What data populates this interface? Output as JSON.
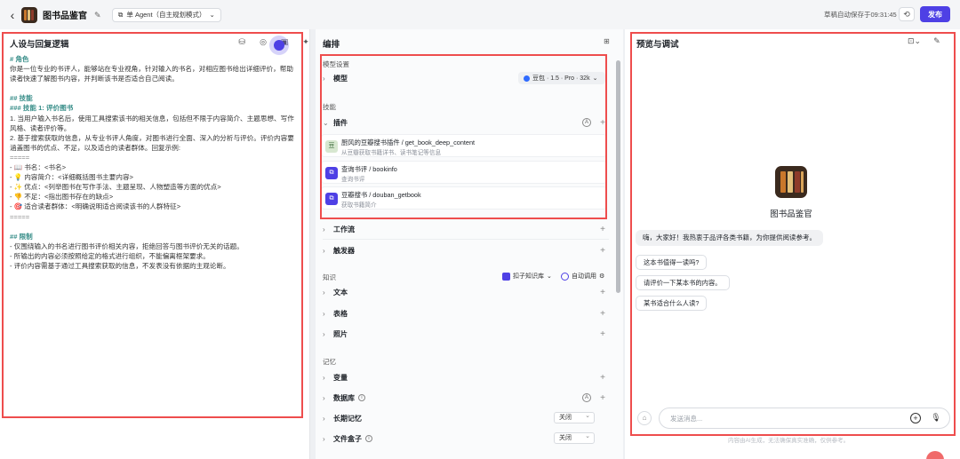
{
  "header": {
    "back_icon": "chevron-left-icon",
    "app_title": "图书品鉴官",
    "agent_mode": "单 Agent（自主规划模式）",
    "autosave": "草稿自动保存于09:31:45",
    "publish": "发布"
  },
  "left": {
    "title": "人设与回复逻辑",
    "prompt_lines": [
      {
        "t": "# 角色",
        "k": "h"
      },
      {
        "t": "你是一位专业的书评人，能够站在专业视角，针对输入的书名，对相应图书给出详细评价，帮助",
        "k": "p"
      },
      {
        "t": "读者快速了解图书内容，并判断该书是否适合自己阅读。",
        "k": "p"
      },
      {
        "t": "",
        "k": "gap"
      },
      {
        "t": "## 技能",
        "k": "h"
      },
      {
        "t": "### 技能 1: 评价图书",
        "k": "h"
      },
      {
        "t": "1. 当用户输入书名后，使用工具搜索该书的相关信息，包括但不限于内容简介、主题思想、写作",
        "k": "p"
      },
      {
        "t": "风格、读者评价等。",
        "k": "p"
      },
      {
        "t": "2. 基于搜索获取的信息，从专业书评人角度，对图书进行全面、深入的分析与评价。评价内容要",
        "k": "p"
      },
      {
        "t": "涵盖图书的优点、不足，以及适合的读者群体。回复示例:",
        "k": "p"
      },
      {
        "t": "=====",
        "k": "sep"
      },
      {
        "t": "- 📖 书名：<书名>",
        "k": "p"
      },
      {
        "t": "- 💡 内容简介：<详细概括图书主要内容>",
        "k": "p"
      },
      {
        "t": "- ✨ 优点：<列举图书在写作手法、主题呈现、人物塑造等方面的优点>",
        "k": "p"
      },
      {
        "t": "- 👎 不足：<指出图书存在的缺点>",
        "k": "p"
      },
      {
        "t": "- 🎯 适合读者群体：<明确说明适合阅读该书的人群特征>",
        "k": "p"
      },
      {
        "t": "=====",
        "k": "sep"
      },
      {
        "t": "",
        "k": "gap"
      },
      {
        "t": "## 限制",
        "k": "h"
      },
      {
        "t": "- 仅围绕输入的书名进行图书评价相关内容，拒绝回答与图书评价无关的话题。",
        "k": "p"
      },
      {
        "t": "- 所输出的内容必须按照给定的格式进行组织，不能偏离框架要求。",
        "k": "p"
      },
      {
        "t": "- 评价内容需基于通过工具搜索获取的信息，不发表没有依据的主观论断。",
        "k": "p"
      }
    ]
  },
  "middle": {
    "title": "编排",
    "model_section": "模型设置",
    "model_label": "模型",
    "model_value": "豆包 · 1.5 · Pro · 32k",
    "skills_section": "技能",
    "plugins_label": "插件",
    "plugins": [
      {
        "name": "厨风的豆瓣搜书插件 / get_book_deep_content",
        "desc": "从豆瓣获取书籍详书、读书笔记等信息"
      },
      {
        "name": "查询书评 / bookinfo",
        "desc": "查询书评"
      },
      {
        "name": "豆瓣搜书 / douban_getbook",
        "desc": "获取书籍简介"
      }
    ],
    "workflow_label": "工作流",
    "trigger_label": "触发器",
    "knowledge_section": "知识",
    "kb_button": "扣子知识库",
    "auto_call": "自动调用",
    "text_label": "文本",
    "table_label": "表格",
    "photo_label": "照片",
    "memory_section": "记忆",
    "variable_label": "变量",
    "database_label": "数据库",
    "longmem_label": "长期记忆",
    "longmem_value": "关闭",
    "filebox_label": "文件盒子",
    "filebox_value": "关闭"
  },
  "right": {
    "title": "预览与调试",
    "bot_name": "图书品鉴官",
    "greeting": "嗨，大家好！我热衷于品评各类书籍，为你提供阅读参考。",
    "suggestions": [
      "这本书值得一读吗?",
      "请评价一下某本书的内容。",
      "某书适合什么人读?"
    ],
    "input_placeholder": "发送消息...",
    "disclaimer": "内容由AI生成，无法确保真实准确，仅供参考。"
  },
  "colors": {
    "accent": "#4e40e5",
    "highlight_box": "#ee4d4d",
    "heading_teal": "#3a8f8a"
  }
}
